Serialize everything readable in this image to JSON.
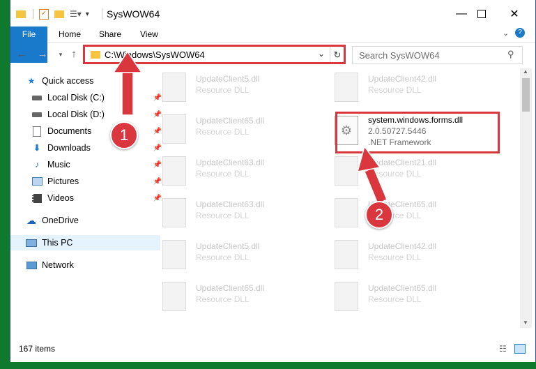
{
  "window": {
    "title": "SysWOW64"
  },
  "ribbon": {
    "tabs": [
      "File",
      "Home",
      "Share",
      "View"
    ]
  },
  "address": {
    "path": "C:\\Windows\\SysWOW64"
  },
  "search": {
    "placeholder": "Search SysWOW64"
  },
  "nav": {
    "items": [
      {
        "label": "Quick access",
        "icon": "star-icon",
        "pinned": false
      },
      {
        "label": "Local Disk (C:)",
        "icon": "drive-icon",
        "pinned": true
      },
      {
        "label": "Local Disk (D:)",
        "icon": "drive-icon",
        "pinned": true
      },
      {
        "label": "Documents",
        "icon": "document-icon",
        "pinned": true
      },
      {
        "label": "Downloads",
        "icon": "download-icon",
        "pinned": true
      },
      {
        "label": "Music",
        "icon": "music-icon",
        "pinned": true
      },
      {
        "label": "Pictures",
        "icon": "picture-icon",
        "pinned": true
      },
      {
        "label": "Videos",
        "icon": "video-icon",
        "pinned": true
      },
      {
        "label": "OneDrive",
        "icon": "cloud-icon",
        "pinned": false
      },
      {
        "label": "This PC",
        "icon": "computer-icon",
        "pinned": false
      },
      {
        "label": "Network",
        "icon": "network-icon",
        "pinned": false
      }
    ]
  },
  "files": [
    {
      "name": "UpdateClient5.dll",
      "desc": "Resource DLL"
    },
    {
      "name": "UpdateClient42.dll",
      "desc": "Resource DLL"
    },
    {
      "name": "UpdateClient65.dll",
      "desc": "Resource DLL"
    },
    {
      "name": "system.windows.forms.dll",
      "version": "2.0.50727.5446",
      "desc": ".NET Framework"
    },
    {
      "name": "UpdateClient63.dll",
      "desc": "Resource DLL"
    },
    {
      "name": "UpdateClient21.dll",
      "desc": "Resource DLL"
    },
    {
      "name": "UpdateClient63.dll",
      "desc": "Resource DLL"
    },
    {
      "name": "UpdateClient65.dll",
      "desc": "Resource DLL"
    },
    {
      "name": "UpdateClient5.dll",
      "desc": "Resource DLL"
    },
    {
      "name": "UpdateClient42.dll",
      "desc": "Resource DLL"
    },
    {
      "name": "UpdateClient65.dll",
      "desc": "Resource DLL"
    },
    {
      "name": "UpdateClient65.dll",
      "desc": "Resource DLL"
    }
  ],
  "status": {
    "count": "167 items"
  },
  "annotations": {
    "badge1": "1",
    "badge2": "2"
  },
  "colors": {
    "highlight": "#d9363e",
    "file_tab": "#1979ca",
    "background": "#0f7a2e"
  }
}
